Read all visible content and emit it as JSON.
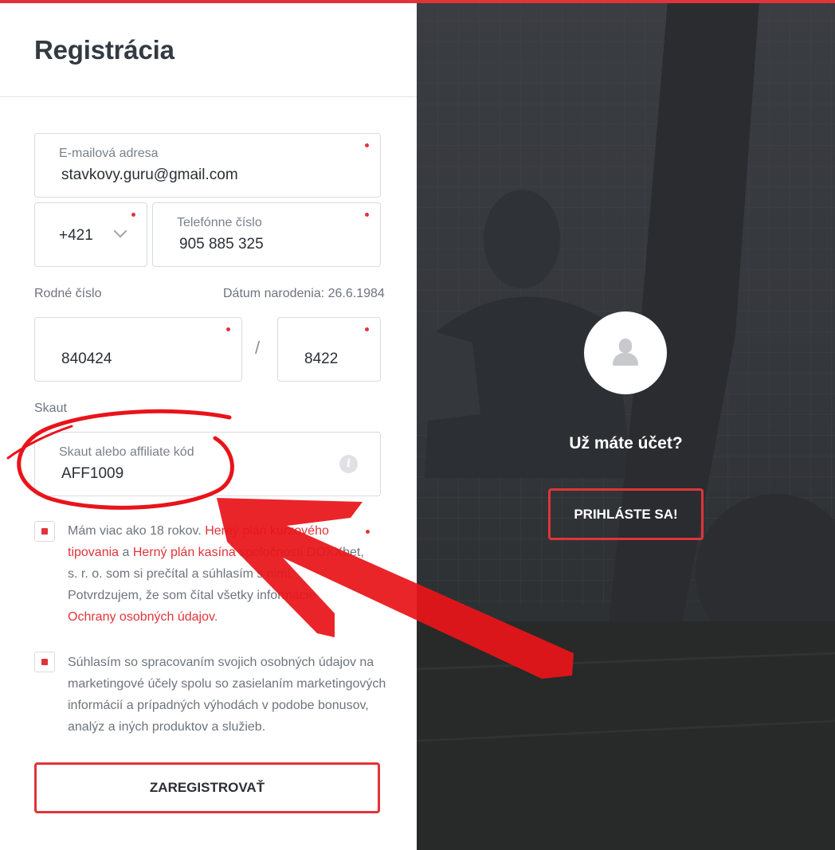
{
  "header": {
    "title": "Registrácia"
  },
  "form": {
    "email": {
      "label": "E-mailová adresa",
      "value": "stavkovy.guru@gmail.com"
    },
    "phone_prefix": {
      "value": "+421"
    },
    "phone": {
      "label": "Telefónne číslo",
      "value": "905 885 325"
    },
    "birth_number": {
      "label": "Rodné číslo",
      "date_of_birth": "Dátum narodenia: 26.6.1984",
      "part1": "840424",
      "separator": "/",
      "part2": "8422"
    },
    "scout": {
      "section_label": "Skaut",
      "label": "Skaut alebo affiliate kód",
      "value": "AFF1009",
      "info_icon": "i"
    },
    "consent_age": {
      "t1": "Mám viac ako 18 rokov. ",
      "l1": "Herný plán kurzového",
      "t2": "tipovania",
      "t3": " a ",
      "l2": "Herný plán kasína",
      "t4": " spoločnosti DOXXbet,",
      "t5": "s. r. o. som si prečítal a súhlasím s nimi.",
      "t6": "Potvrdzujem, že som čítal všetky informácie",
      "l3": "Ochrany osobných údajov",
      "t7": "."
    },
    "consent_marketing": {
      "line1": "Súhlasím so spracovaním svojich osobných údajov na",
      "line2": "marketingové účely spolu so zasielaním marketingových",
      "line3": "informácií a prípadných výhodách v podobe bonusov,",
      "line4": "analýz a iných produktov a služieb."
    },
    "submit_label": "ZAREGISTROVAŤ"
  },
  "login_panel": {
    "prompt": "Už máte účet?",
    "button_label": "PRIHLÁSTE SA!"
  },
  "colors": {
    "accent": "#e0343a",
    "text_dark": "#2b2f35",
    "text_muted": "#6e747c",
    "border": "#d8dbdf",
    "annotation": "#e8141a"
  },
  "icons": [
    "chevron-down-icon",
    "info-icon",
    "user-avatar-icon",
    "required-dot-icon"
  ]
}
